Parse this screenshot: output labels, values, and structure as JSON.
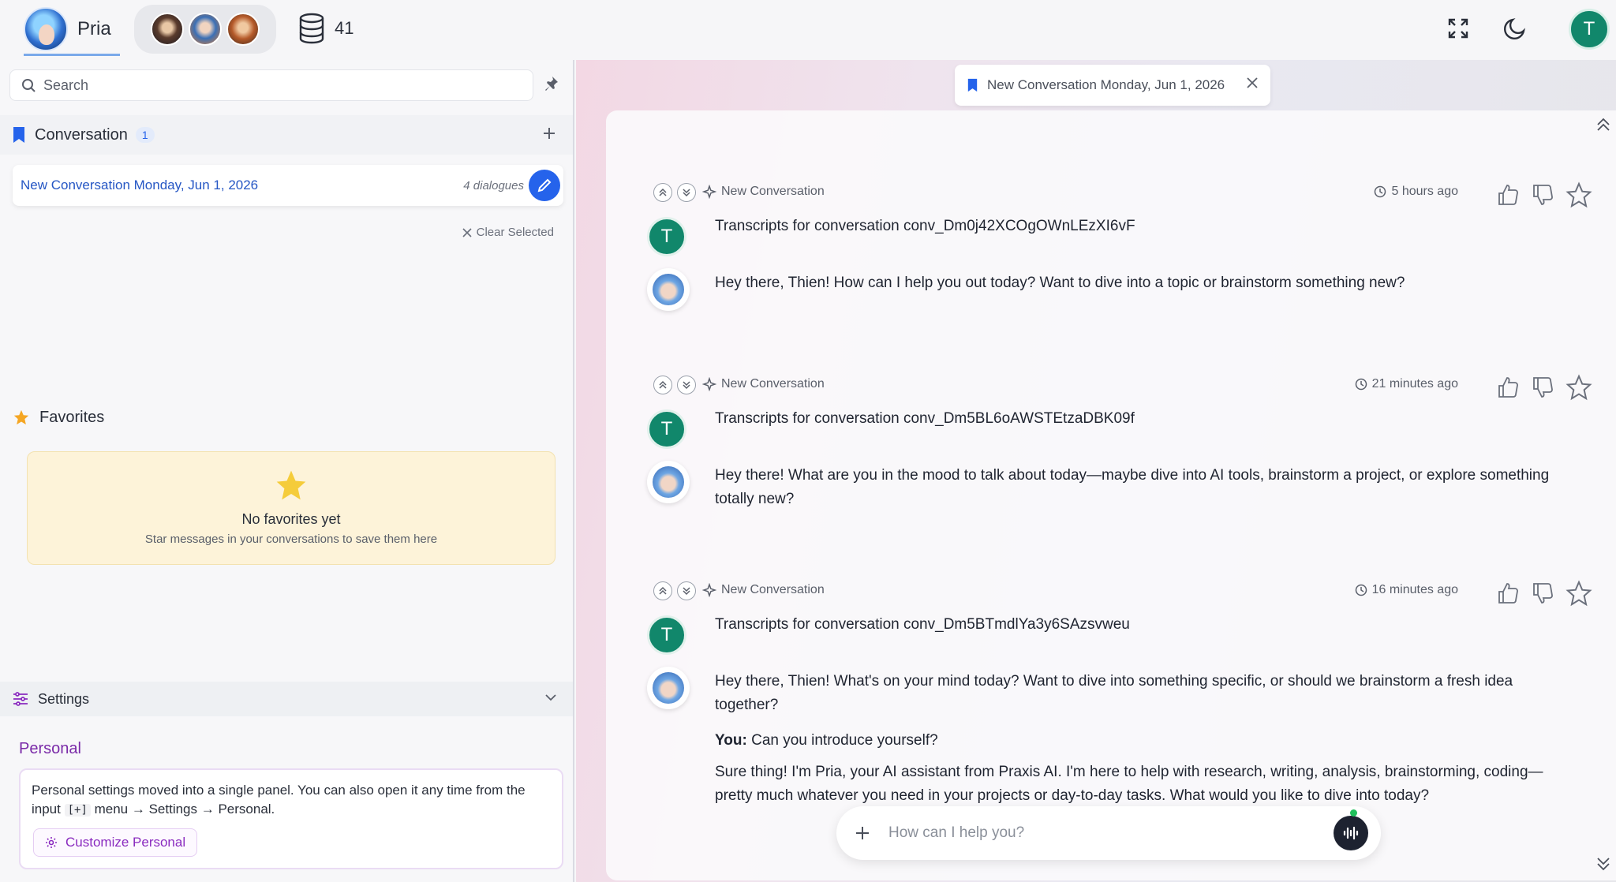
{
  "topbar": {
    "agent_name": "Pria",
    "db_count": "41",
    "user_initial": "T"
  },
  "sidebar": {
    "search_placeholder": "Search",
    "conversation_section": {
      "title": "Conversation",
      "count": "1",
      "items": [
        {
          "title": "New Conversation Monday, Jun 1, 2026",
          "dialogues": "4 dialogues"
        }
      ],
      "clear_selected": "Clear Selected"
    },
    "favorites": {
      "title": "Favorites",
      "empty_title": "No favorites yet",
      "empty_subtitle": "Star messages in your conversations to save them here"
    },
    "settings": {
      "title": "Settings",
      "personal_title": "Personal",
      "personal_text_1": "Personal settings moved into a single panel. You can also open it any time from the input ",
      "personal_code": "[+]",
      "personal_text_2": " menu → Settings → Personal.",
      "customize_button": "Customize Personal"
    }
  },
  "main": {
    "tab_title": "New Conversation Monday, Jun 1, 2026",
    "messages": [
      {
        "label": "New Conversation",
        "time": "5 hours ago",
        "user_initial": "T",
        "user_text": "Transcripts for conversation conv_Dm0j42XCOgOWnLEzXI6vF",
        "ai_text": "Hey there, Thien! How can I help you out today? Want to dive into a topic or brainstorm something new?"
      },
      {
        "label": "New Conversation",
        "time": "21 minutes ago",
        "user_initial": "T",
        "user_text": "Transcripts for conversation conv_Dm5BL6oAWSTEtzaDBK09f",
        "ai_text": "Hey there! What are you in the mood to talk about today—maybe dive into AI tools, brainstorm a project, or explore something totally new?"
      },
      {
        "label": "New Conversation",
        "time": "16 minutes ago",
        "user_initial": "T",
        "user_text": "Transcripts for conversation conv_Dm5BTmdlYa3y6SAzsvweu",
        "ai_text": "Hey there, Thien! What's on your mind today? Want to dive into something specific, or should we brainstorm a fresh idea together?",
        "you_label": "You:",
        "you_text": " Can you introduce yourself?",
        "ai_text_2": "Sure thing! I'm Pria, your AI assistant from Praxis AI. I'm here to help with research, writing, analysis, brainstorming, coding—pretty much whatever you need in your projects or day-to-day tasks. What would you like to dive into today?"
      }
    ],
    "input_placeholder": "How can I help you?"
  },
  "colors": {
    "accent_blue": "#2563eb",
    "user_avatar_green": "#11876b",
    "personal_purple": "#8a2bbf",
    "favorites_star": "#f5a623"
  },
  "icons": [
    "database-icon",
    "fullscreen-icon",
    "moon-icon",
    "search-icon",
    "pin-icon",
    "bookmark-icon",
    "plus-icon",
    "pencil-icon",
    "close-icon",
    "star-icon",
    "sliders-icon",
    "chevron-down-icon",
    "gear-icon",
    "sparkle-icon",
    "clock-icon",
    "thumbs-up-icon",
    "thumbs-down-icon",
    "double-chevron-up-icon",
    "double-chevron-down-icon",
    "voice-icon"
  ]
}
